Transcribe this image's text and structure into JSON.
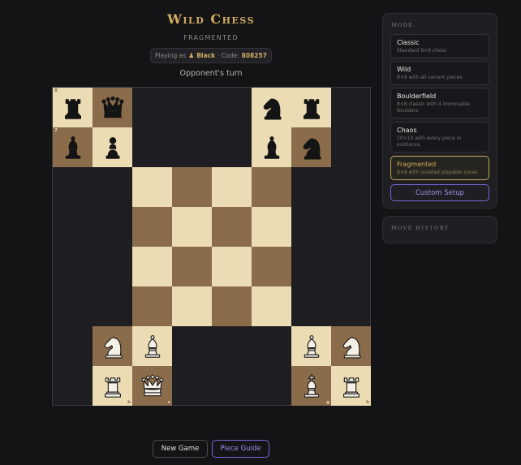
{
  "header": {
    "title": "Wild Chess",
    "subtitle": "FRAGMENTED",
    "player_prefix": "Playing as",
    "player_color": "Black",
    "code_prefix": "· Code:",
    "code": "808257",
    "turn_status": "Opponent's turn"
  },
  "board": {
    "rank_labels": [
      {
        "sq": "a8",
        "text": "8"
      },
      {
        "sq": "a7",
        "text": "7"
      }
    ],
    "file_labels": [
      {
        "sq": "b1",
        "text": "b"
      },
      {
        "sq": "c1",
        "text": "c"
      },
      {
        "sq": "g1",
        "text": "g"
      },
      {
        "sq": "h1",
        "text": "h"
      }
    ],
    "squares": [
      {
        "sq": "a8",
        "shade": "light",
        "piece": "rook",
        "color": "black"
      },
      {
        "sq": "b8",
        "shade": "dark",
        "piece": "queen",
        "color": "black"
      },
      {
        "sq": "f8",
        "shade": "light",
        "piece": "knight",
        "color": "black"
      },
      {
        "sq": "g8",
        "shade": "light",
        "piece": "rook",
        "color": "black"
      },
      {
        "sq": "a7",
        "shade": "dark",
        "piece": "bishop",
        "color": "black"
      },
      {
        "sq": "b7",
        "shade": "light",
        "piece": "pawn",
        "color": "black"
      },
      {
        "sq": "f7",
        "shade": "light",
        "piece": "bishop",
        "color": "black"
      },
      {
        "sq": "g7",
        "shade": "dark",
        "piece": "knight",
        "color": "black"
      },
      {
        "sq": "c6",
        "shade": "light"
      },
      {
        "sq": "d6",
        "shade": "dark"
      },
      {
        "sq": "e6",
        "shade": "light"
      },
      {
        "sq": "f6",
        "shade": "dark"
      },
      {
        "sq": "c5",
        "shade": "dark"
      },
      {
        "sq": "d5",
        "shade": "light"
      },
      {
        "sq": "e5",
        "shade": "dark"
      },
      {
        "sq": "f5",
        "shade": "light"
      },
      {
        "sq": "c4",
        "shade": "light"
      },
      {
        "sq": "d4",
        "shade": "dark"
      },
      {
        "sq": "e4",
        "shade": "light"
      },
      {
        "sq": "f4",
        "shade": "dark"
      },
      {
        "sq": "c3",
        "shade": "dark"
      },
      {
        "sq": "d3",
        "shade": "light"
      },
      {
        "sq": "e3",
        "shade": "dark"
      },
      {
        "sq": "f3",
        "shade": "light"
      },
      {
        "sq": "b2",
        "shade": "dark",
        "piece": "knight",
        "color": "white"
      },
      {
        "sq": "c2",
        "shade": "light",
        "piece": "bishop",
        "color": "white"
      },
      {
        "sq": "g2",
        "shade": "light",
        "piece": "bishop",
        "color": "white"
      },
      {
        "sq": "h2",
        "shade": "dark",
        "piece": "knight",
        "color": "white"
      },
      {
        "sq": "b1",
        "shade": "light",
        "piece": "rook",
        "color": "white"
      },
      {
        "sq": "c1",
        "shade": "dark",
        "piece": "queen",
        "color": "white"
      },
      {
        "sq": "g1",
        "shade": "dark",
        "piece": "king",
        "color": "white"
      },
      {
        "sq": "h1",
        "shade": "light",
        "piece": "rook",
        "color": "white"
      }
    ]
  },
  "actions": {
    "new_game": "New Game",
    "piece_guide": "Piece Guide"
  },
  "sidebar": {
    "mode_title": "MODE",
    "modes": [
      {
        "name": "Classic",
        "desc": "Standard 8×8 chess",
        "selected": false
      },
      {
        "name": "Wild",
        "desc": "8×8 with all variant pieces",
        "selected": false
      },
      {
        "name": "Boulderfield",
        "desc": "8×8 classic with 4 immovable Boulders",
        "selected": false
      },
      {
        "name": "Chaos",
        "desc": "10×10 with every piece in existance",
        "selected": false
      },
      {
        "name": "Fragmented",
        "desc": "8×8 with isolated playable zones",
        "selected": true
      }
    ],
    "custom_setup": "Custom Setup",
    "history_title": "MOVE HISTORY"
  },
  "colors": {
    "gold_accent": "#d2ad62",
    "purple_accent": "#a48ef0",
    "light_square": "#ecdcb3",
    "dark_square": "#8a6c4b",
    "background": "#141416"
  }
}
